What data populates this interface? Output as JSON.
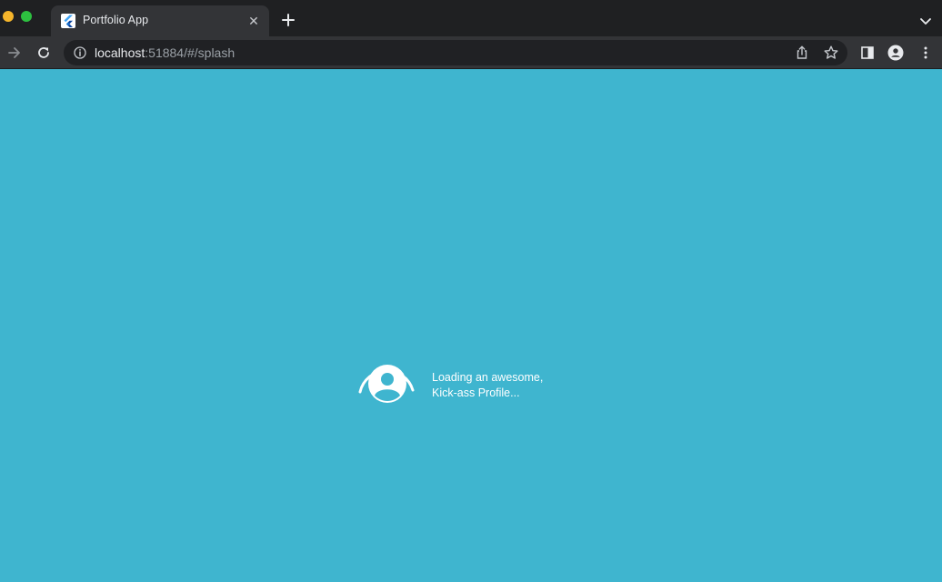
{
  "browser": {
    "tab": {
      "title": "Portfolio App",
      "close_glyph": "✕"
    },
    "url": {
      "host": "localhost",
      "path": ":51884/#/splash"
    }
  },
  "splash": {
    "line1": "Loading an awesome,",
    "line2": "Kick-ass Profile..."
  },
  "colors": {
    "page_background": "#3fb5cf",
    "chrome_dark": "#1f2022",
    "toolbar": "#333437",
    "accent_white": "#ffffff"
  },
  "icons": [
    "flutter-favicon-icon",
    "close-icon",
    "plus-icon",
    "chevron-down-icon",
    "arrow-forward-icon",
    "reload-icon",
    "info-icon",
    "share-icon",
    "star-icon",
    "side-panel-icon",
    "profile-icon",
    "more-vert-icon",
    "account-circle-icon"
  ]
}
